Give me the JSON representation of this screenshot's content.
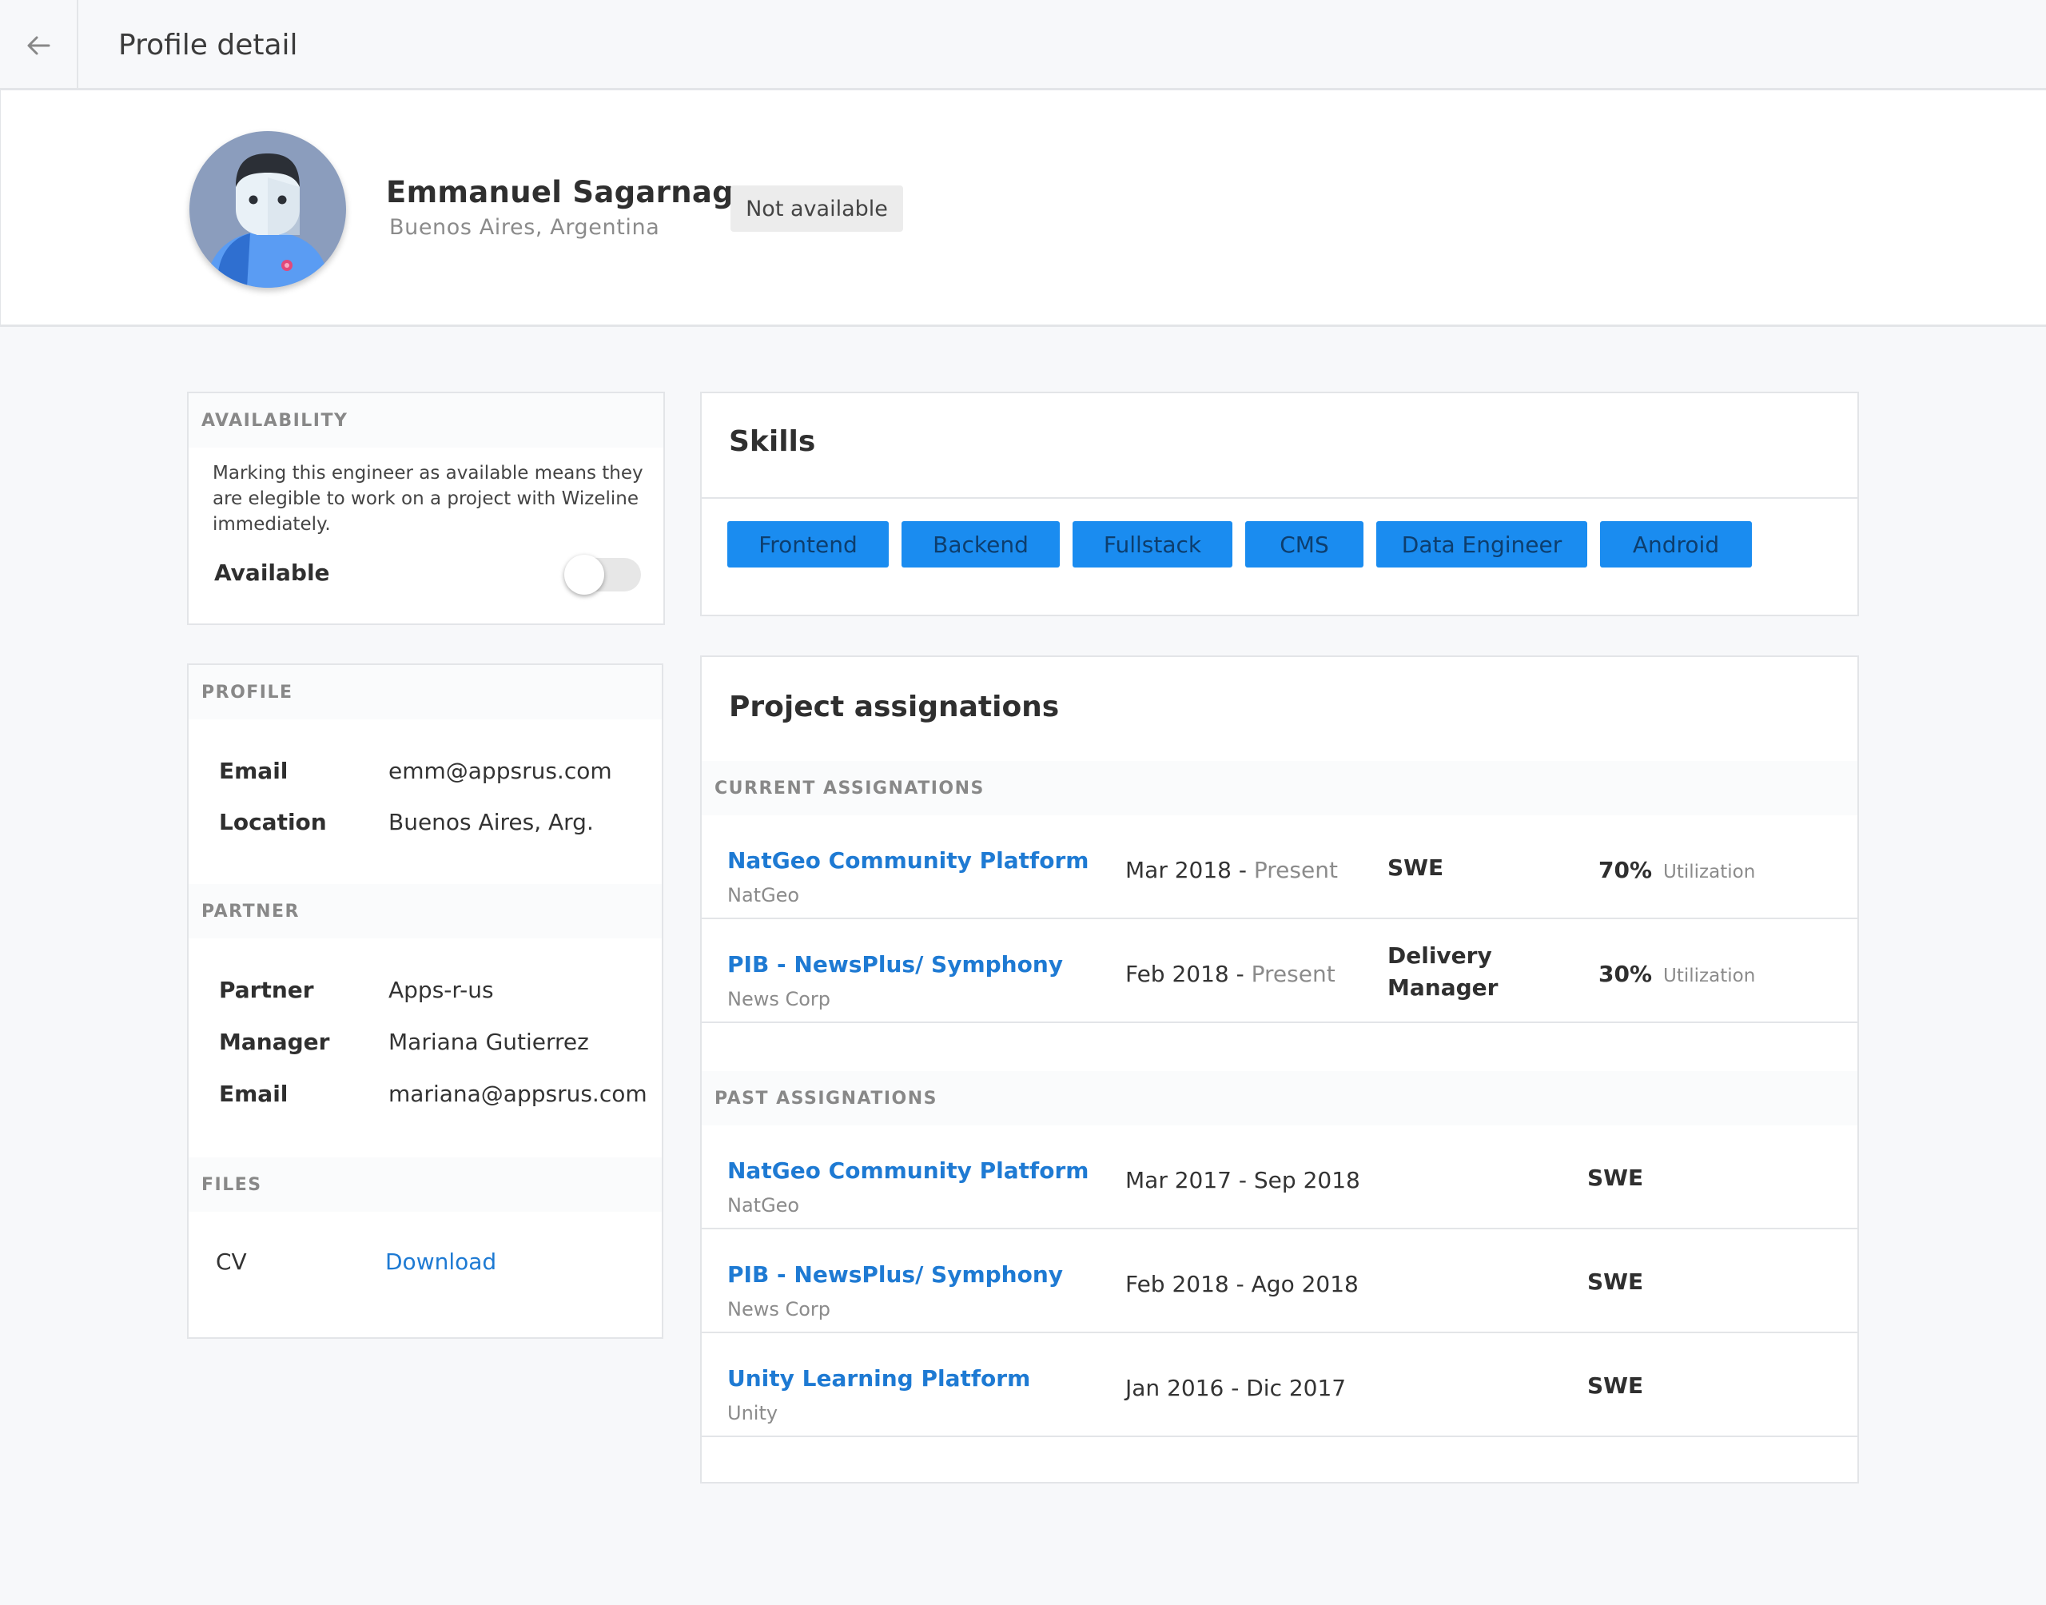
{
  "topbar": {
    "title": "Profile detail"
  },
  "profile": {
    "name": "Emmanuel Sagarnaga",
    "location": "Buenos Aires, Argentina",
    "status": "Not available"
  },
  "availability": {
    "heading": "AVAILABILITY",
    "description": "Marking this engineer as available means they are elegible to work on a project with Wizeline immediately.",
    "toggle_label": "Available",
    "toggle_on": false
  },
  "profile_section": {
    "heading": "PROFILE",
    "fields": [
      {
        "label": "Email",
        "value": "emm@appsrus.com"
      },
      {
        "label": "Location",
        "value": "Buenos Aires, Arg."
      }
    ]
  },
  "partner_section": {
    "heading": "PARTNER",
    "fields": [
      {
        "label": "Partner",
        "value": "Apps-r-us"
      },
      {
        "label": "Manager",
        "value": "Mariana Gutierrez"
      },
      {
        "label": "Email",
        "value": "mariana@appsrus.com"
      }
    ]
  },
  "files_section": {
    "heading": "FILES",
    "file_label": "CV",
    "link_label": "Download"
  },
  "skills": {
    "title": "Skills",
    "items": [
      "Frontend",
      "Backend",
      "Fullstack",
      "CMS",
      "Data Engineer",
      "Android"
    ]
  },
  "projects": {
    "title": "Project assignations",
    "current_heading": "CURRENT ASSIGNATIONS",
    "past_heading": "PAST ASSIGNATIONS",
    "current": [
      {
        "name": "NatGeo Community Platform",
        "client": "NatGeo",
        "start": "Mar 2018 - ",
        "end": "Present",
        "role": "SWE",
        "utilization": "70%",
        "utilization_label": "Utilization"
      },
      {
        "name": "PIB - NewsPlus/ Symphony",
        "client": "News Corp",
        "start": "Feb 2018 - ",
        "end": "Present",
        "role_line1": "Delivery",
        "role_line2": "Manager",
        "utilization": "30%",
        "utilization_label": "Utilization"
      }
    ],
    "past": [
      {
        "name": "NatGeo Community Platform",
        "client": "NatGeo",
        "dates": "Mar 2017 - Sep 2018",
        "role": "SWE"
      },
      {
        "name": "PIB - NewsPlus/ Symphony",
        "client": "News Corp",
        "dates": "Feb 2018 - Ago 2018",
        "role": "SWE"
      },
      {
        "name": "Unity Learning Platform",
        "client": "Unity",
        "dates": "Jan 2016 - Dic 2017",
        "role": "SWE"
      }
    ]
  },
  "colors": {
    "accent": "#1a8cf0",
    "link": "#1e7ad3"
  },
  "icons": {
    "back": "arrow-left-icon"
  }
}
